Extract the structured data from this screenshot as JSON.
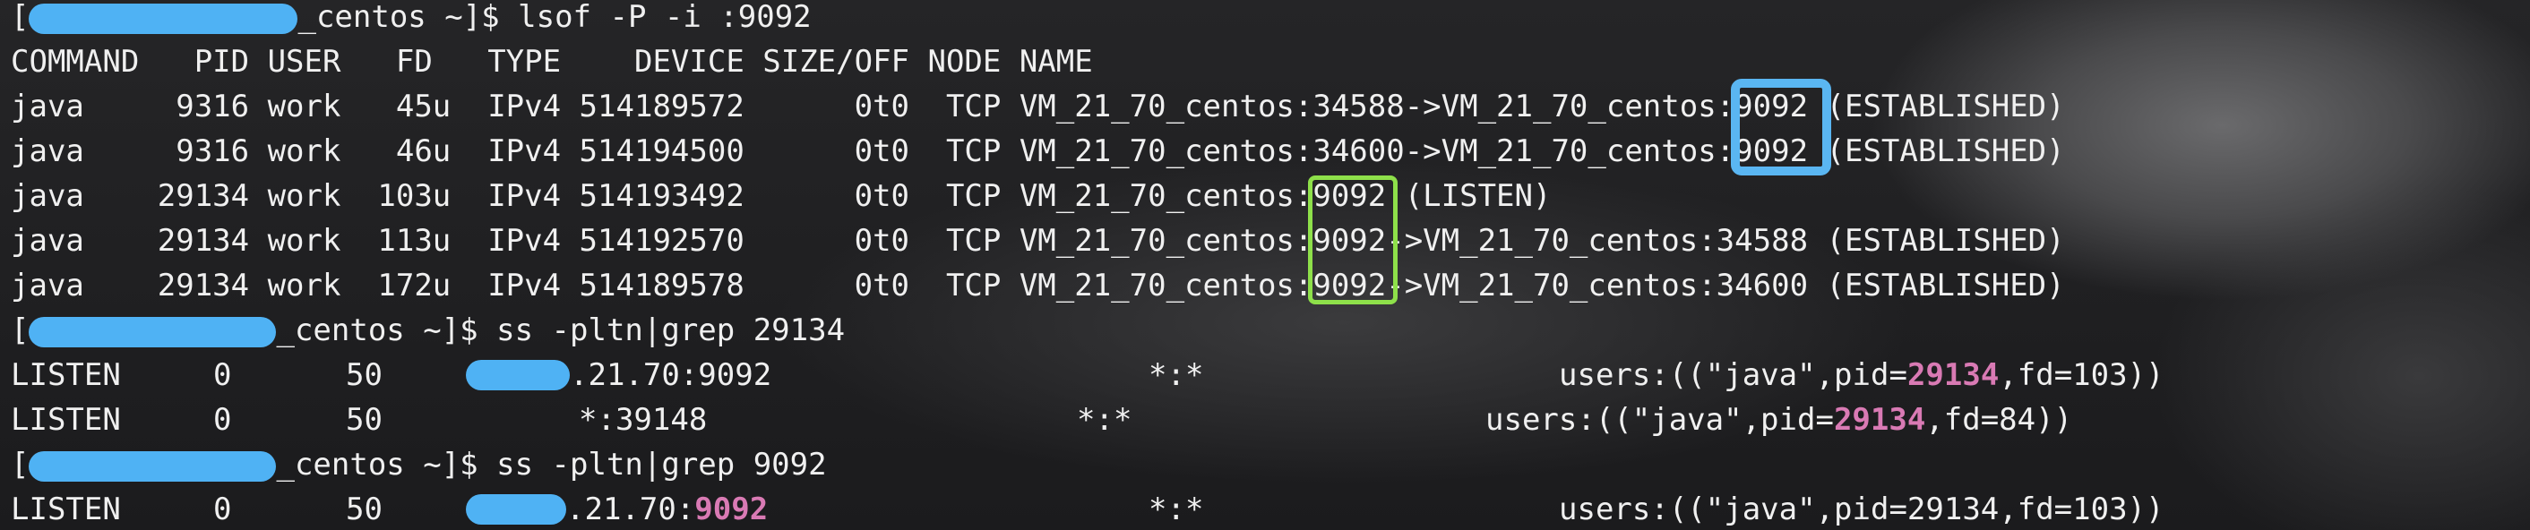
{
  "prompt1": {
    "open": "[",
    "suffix": "_centos ~]$ ",
    "command": "lsof -P -i :9092"
  },
  "lsof": {
    "header": "COMMAND   PID USER   FD   TYPE    DEVICE SIZE/OFF NODE NAME",
    "rows": [
      "java     9316 work   45u  IPv4 514189572      0t0  TCP VM_21_70_centos:34588->VM_21_70_centos:9092 (ESTABLISHED)",
      "java     9316 work   46u  IPv4 514194500      0t0  TCP VM_21_70_centos:34600->VM_21_70_centos:9092 (ESTABLISHED)",
      "java    29134 work  103u  IPv4 514193492      0t0  TCP VM_21_70_centos:9092 (LISTEN)",
      "java    29134 work  113u  IPv4 514192570      0t0  TCP VM_21_70_centos:9092->VM_21_70_centos:34588 (ESTABLISHED)",
      "java    29134 work  172u  IPv4 514189578      0t0  TCP VM_21_70_centos:9092->VM_21_70_centos:34600 (ESTABLISHED)"
    ]
  },
  "prompt2": {
    "open": "[",
    "suffix": "_centos ~]$ ",
    "command": "ss -pltn|grep 29134"
  },
  "ss1": [
    {
      "state": "LISTEN",
      "recvq": "0",
      "sendq": "50",
      "local": ".21.70:9092",
      "peer": "*:*",
      "users_pre": "users:((\"java\",pid=",
      "pid": "29134",
      "users_post": ",fd=103))"
    },
    {
      "state": "LISTEN",
      "recvq": "0",
      "sendq": "50",
      "local": "*:39148",
      "peer": "*:*",
      "users_pre": "users:((\"java\",pid=",
      "pid": "29134",
      "users_post": ",fd=84))"
    }
  ],
  "prompt3": {
    "open": "[",
    "suffix": "_centos ~]$ ",
    "command": "ss -pltn|grep 9092"
  },
  "ss2": [
    {
      "state": "LISTEN",
      "recvq": "0",
      "sendq": "50",
      "local_pre": ".21.70:",
      "port": "9092",
      "peer": "*:*",
      "users": "users:((\"java\",pid=29134,fd=103))"
    }
  ],
  "colors": {
    "redaction": "#4fb2f4",
    "highlight_blue": "#5ab6f2",
    "highlight_green": "#8ee04a",
    "match_pink": "#d97ab4"
  }
}
